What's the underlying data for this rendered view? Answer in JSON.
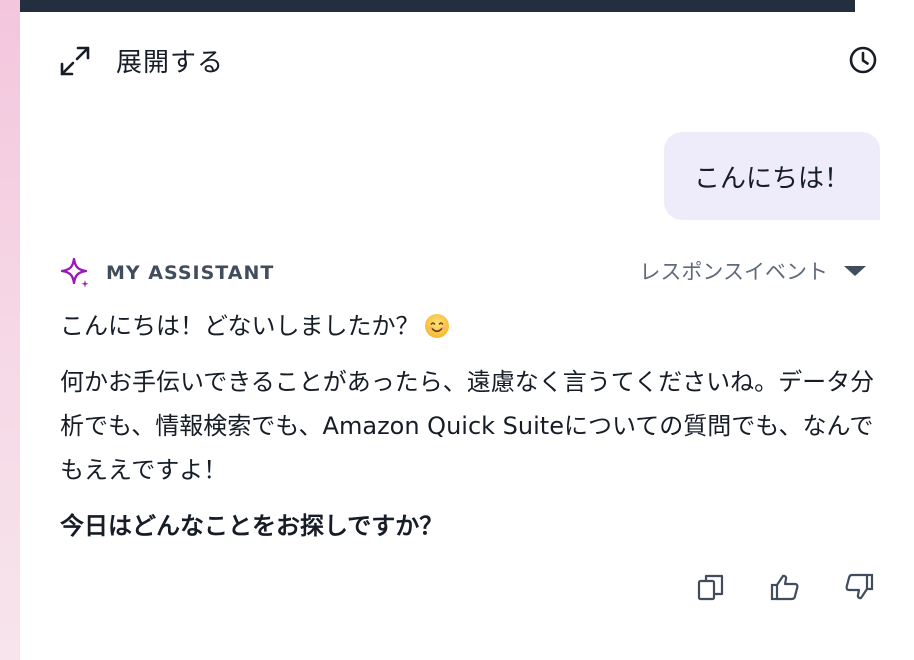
{
  "header": {
    "expand_label": "展開する",
    "icons": {
      "expand": "expand-arrows-icon",
      "history": "clock-icon"
    }
  },
  "conversation": {
    "user_message": "こんにちは！",
    "assistant": {
      "name": "MY ASSISTANT",
      "icon": "sparkle-icon",
      "response_events_label": "レスポンスイベント",
      "greeting": "こんにちは！どないしましたか？",
      "greeting_emoji": "smiling-face-emoji",
      "body": "何かお手伝いできることがあったら、遠慮なく言うてくださいね。データ分析でも、情報検索でも、Amazon Quick Suiteについての質問でも、なんでもええですよ！",
      "question": "今日はどんなことをお探しですか？"
    },
    "actions": [
      "copy-icon",
      "thumbs-up-icon",
      "thumbs-down-icon"
    ]
  },
  "colors": {
    "accent_sparkle": "#9b19b9",
    "user_bubble": "#eeecfb",
    "top_bar": "#232f3e",
    "left_strip": "#f3c6dd"
  }
}
